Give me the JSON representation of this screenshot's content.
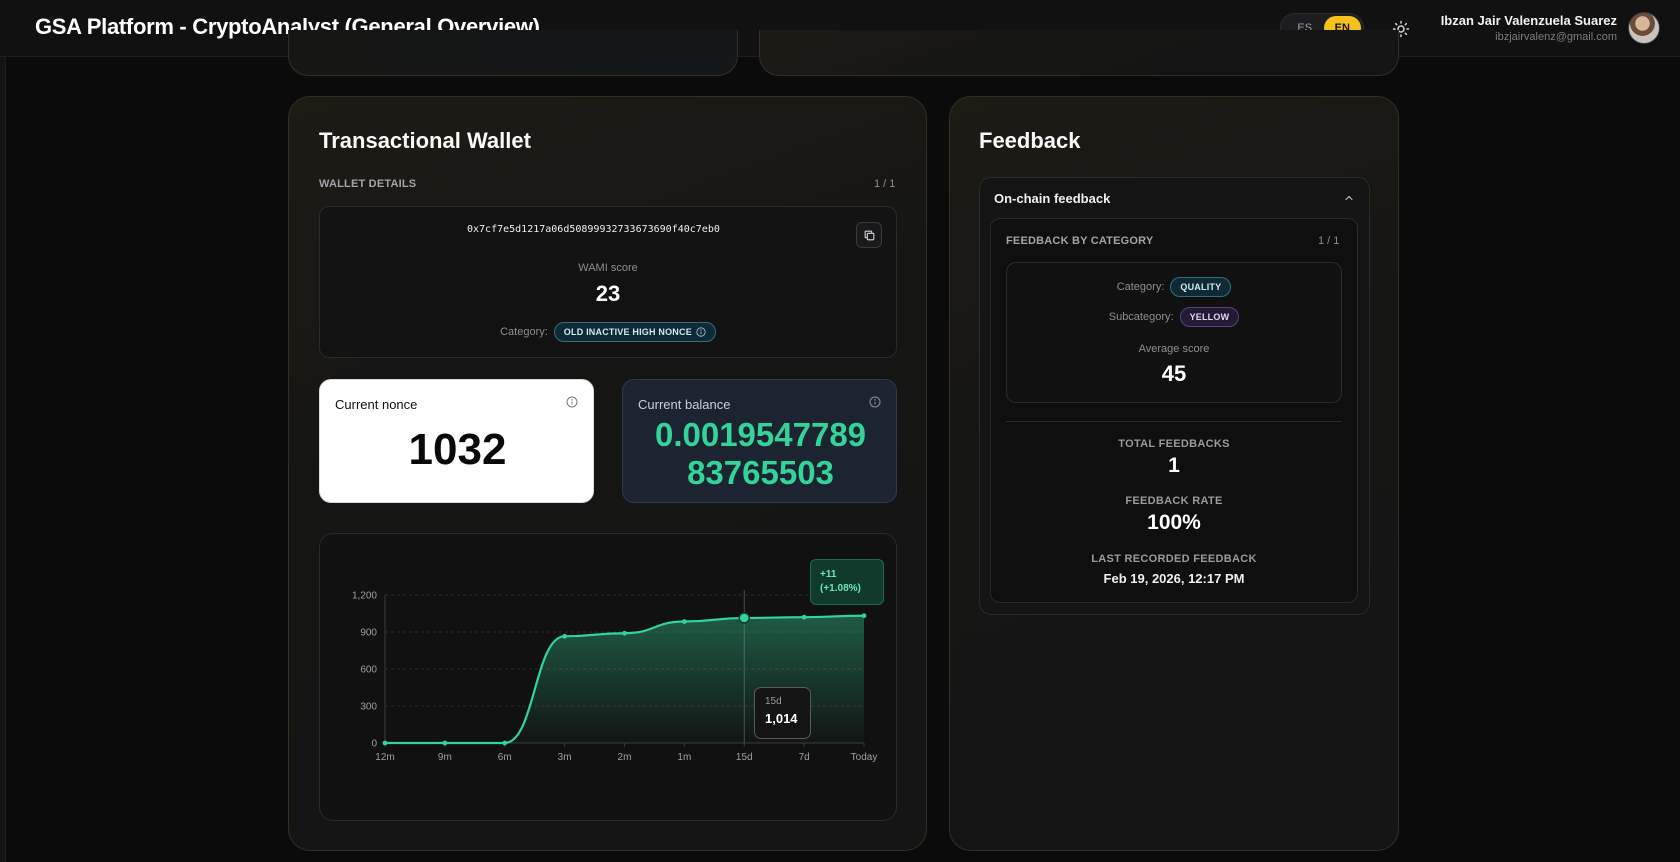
{
  "header": {
    "title": "GSA Platform - CryptoAnalyst (General Overview)",
    "lang_es": "ES",
    "lang_en": "EN",
    "active_lang": "EN",
    "user_name": "Ibzan Jair Valenzuela Suarez",
    "user_email": "ibzjairvalenz@gmail.com"
  },
  "wallet": {
    "title": "Transactional Wallet",
    "details_label": "WALLET DETAILS",
    "pager": "1 / 1",
    "address": "0x7cf7e5d1217a06d50899932733673690f40c7eb0",
    "wami_label": "WAMI score",
    "wami_score": "23",
    "category_label": "Category:",
    "category_value": "OLD INACTIVE HIGH NONCE",
    "nonce_label": "Current nonce",
    "nonce_value": "1032",
    "balance_label": "Current balance",
    "balance_line1": "0.0019547789",
    "balance_line2": "83765503"
  },
  "chart_data": {
    "type": "area",
    "categories": [
      "12m",
      "9m",
      "6m",
      "3m",
      "2m",
      "1m",
      "15d",
      "7d",
      "Today"
    ],
    "values": [
      0,
      0,
      0,
      865,
      890,
      985,
      1014,
      1020,
      1032
    ],
    "ylim": [
      0,
      1200
    ],
    "yticks": [
      "0",
      "300",
      "600",
      "900",
      "1,200"
    ],
    "tooltip_label": "15d",
    "tooltip_value": "1,014",
    "change_abs": "+11",
    "change_pct": "(+1.08%)",
    "color": "#34d399"
  },
  "feedback": {
    "title": "Feedback",
    "onchain_label": "On-chain feedback",
    "by_category_label": "FEEDBACK BY CATEGORY",
    "pager": "1 / 1",
    "category_label": "Category:",
    "category_value": "QUALITY",
    "subcategory_label": "Subcategory:",
    "subcategory_value": "YELLOW",
    "avg_label": "Average score",
    "avg_value": "45",
    "total_label": "TOTAL FEEDBACKS",
    "total_value": "1",
    "rate_label": "FEEDBACK RATE",
    "rate_value": "100%",
    "last_label": "LAST RECORDED FEEDBACK",
    "last_value": "Feb 19, 2026, 12:17 PM"
  }
}
